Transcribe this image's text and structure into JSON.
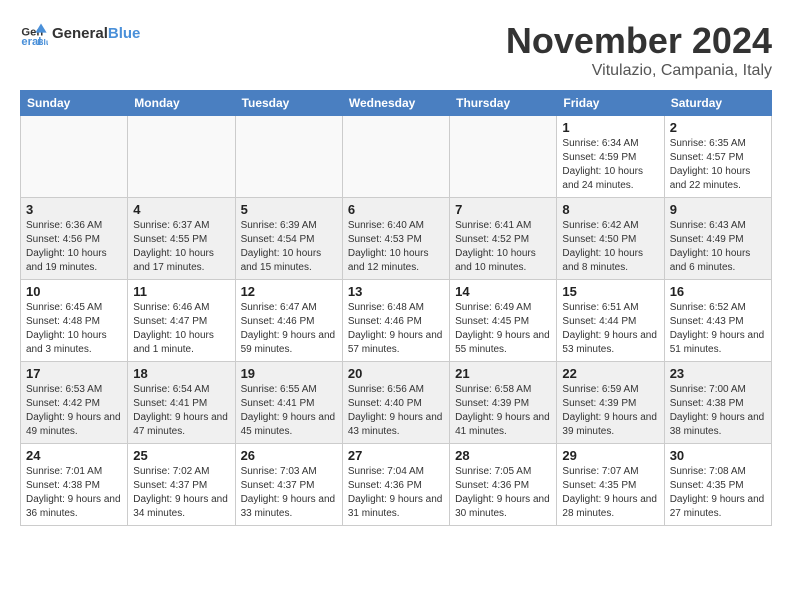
{
  "logo": {
    "line1": "General",
    "line2": "Blue"
  },
  "title": "November 2024",
  "location": "Vitulazio, Campania, Italy",
  "headers": [
    "Sunday",
    "Monday",
    "Tuesday",
    "Wednesday",
    "Thursday",
    "Friday",
    "Saturday"
  ],
  "weeks": [
    [
      {
        "day": "",
        "info": ""
      },
      {
        "day": "",
        "info": ""
      },
      {
        "day": "",
        "info": ""
      },
      {
        "day": "",
        "info": ""
      },
      {
        "day": "",
        "info": ""
      },
      {
        "day": "1",
        "info": "Sunrise: 6:34 AM\nSunset: 4:59 PM\nDaylight: 10 hours and 24 minutes."
      },
      {
        "day": "2",
        "info": "Sunrise: 6:35 AM\nSunset: 4:57 PM\nDaylight: 10 hours and 22 minutes."
      }
    ],
    [
      {
        "day": "3",
        "info": "Sunrise: 6:36 AM\nSunset: 4:56 PM\nDaylight: 10 hours and 19 minutes."
      },
      {
        "day": "4",
        "info": "Sunrise: 6:37 AM\nSunset: 4:55 PM\nDaylight: 10 hours and 17 minutes."
      },
      {
        "day": "5",
        "info": "Sunrise: 6:39 AM\nSunset: 4:54 PM\nDaylight: 10 hours and 15 minutes."
      },
      {
        "day": "6",
        "info": "Sunrise: 6:40 AM\nSunset: 4:53 PM\nDaylight: 10 hours and 12 minutes."
      },
      {
        "day": "7",
        "info": "Sunrise: 6:41 AM\nSunset: 4:52 PM\nDaylight: 10 hours and 10 minutes."
      },
      {
        "day": "8",
        "info": "Sunrise: 6:42 AM\nSunset: 4:50 PM\nDaylight: 10 hours and 8 minutes."
      },
      {
        "day": "9",
        "info": "Sunrise: 6:43 AM\nSunset: 4:49 PM\nDaylight: 10 hours and 6 minutes."
      }
    ],
    [
      {
        "day": "10",
        "info": "Sunrise: 6:45 AM\nSunset: 4:48 PM\nDaylight: 10 hours and 3 minutes."
      },
      {
        "day": "11",
        "info": "Sunrise: 6:46 AM\nSunset: 4:47 PM\nDaylight: 10 hours and 1 minute."
      },
      {
        "day": "12",
        "info": "Sunrise: 6:47 AM\nSunset: 4:46 PM\nDaylight: 9 hours and 59 minutes."
      },
      {
        "day": "13",
        "info": "Sunrise: 6:48 AM\nSunset: 4:46 PM\nDaylight: 9 hours and 57 minutes."
      },
      {
        "day": "14",
        "info": "Sunrise: 6:49 AM\nSunset: 4:45 PM\nDaylight: 9 hours and 55 minutes."
      },
      {
        "day": "15",
        "info": "Sunrise: 6:51 AM\nSunset: 4:44 PM\nDaylight: 9 hours and 53 minutes."
      },
      {
        "day": "16",
        "info": "Sunrise: 6:52 AM\nSunset: 4:43 PM\nDaylight: 9 hours and 51 minutes."
      }
    ],
    [
      {
        "day": "17",
        "info": "Sunrise: 6:53 AM\nSunset: 4:42 PM\nDaylight: 9 hours and 49 minutes."
      },
      {
        "day": "18",
        "info": "Sunrise: 6:54 AM\nSunset: 4:41 PM\nDaylight: 9 hours and 47 minutes."
      },
      {
        "day": "19",
        "info": "Sunrise: 6:55 AM\nSunset: 4:41 PM\nDaylight: 9 hours and 45 minutes."
      },
      {
        "day": "20",
        "info": "Sunrise: 6:56 AM\nSunset: 4:40 PM\nDaylight: 9 hours and 43 minutes."
      },
      {
        "day": "21",
        "info": "Sunrise: 6:58 AM\nSunset: 4:39 PM\nDaylight: 9 hours and 41 minutes."
      },
      {
        "day": "22",
        "info": "Sunrise: 6:59 AM\nSunset: 4:39 PM\nDaylight: 9 hours and 39 minutes."
      },
      {
        "day": "23",
        "info": "Sunrise: 7:00 AM\nSunset: 4:38 PM\nDaylight: 9 hours and 38 minutes."
      }
    ],
    [
      {
        "day": "24",
        "info": "Sunrise: 7:01 AM\nSunset: 4:38 PM\nDaylight: 9 hours and 36 minutes."
      },
      {
        "day": "25",
        "info": "Sunrise: 7:02 AM\nSunset: 4:37 PM\nDaylight: 9 hours and 34 minutes."
      },
      {
        "day": "26",
        "info": "Sunrise: 7:03 AM\nSunset: 4:37 PM\nDaylight: 9 hours and 33 minutes."
      },
      {
        "day": "27",
        "info": "Sunrise: 7:04 AM\nSunset: 4:36 PM\nDaylight: 9 hours and 31 minutes."
      },
      {
        "day": "28",
        "info": "Sunrise: 7:05 AM\nSunset: 4:36 PM\nDaylight: 9 hours and 30 minutes."
      },
      {
        "day": "29",
        "info": "Sunrise: 7:07 AM\nSunset: 4:35 PM\nDaylight: 9 hours and 28 minutes."
      },
      {
        "day": "30",
        "info": "Sunrise: 7:08 AM\nSunset: 4:35 PM\nDaylight: 9 hours and 27 minutes."
      }
    ]
  ]
}
